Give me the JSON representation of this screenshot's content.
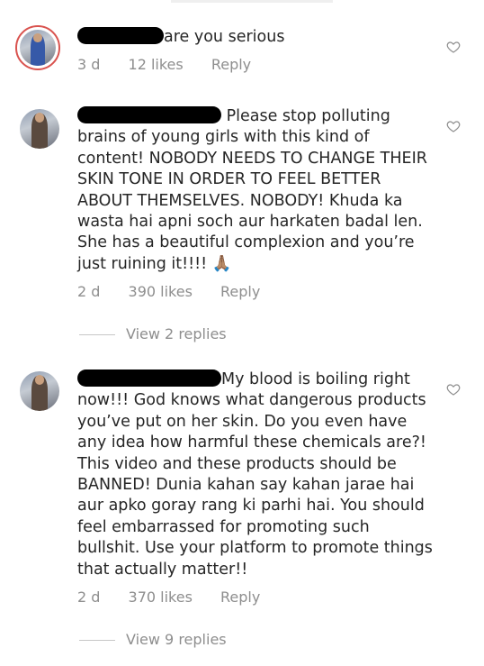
{
  "comments": [
    {
      "text": "are you serious",
      "time": "3 d",
      "likes": "12 likes",
      "reply_label": "Reply"
    },
    {
      "text": "Please stop polluting brains of young girls with this kind of content! NOBODY NEEDS TO CHANGE THEIR SKIN TONE IN ORDER TO FEEL BETTER ABOUT THEMSELVES. NOBODY! Khuda ka wasta hai apni soch aur harkaten badal len. She has a beautiful complexion and you’re just ruining it!!!! 🙏🏽",
      "time": "2 d",
      "likes": "390 likes",
      "reply_label": "Reply",
      "view_replies": "View 2 replies"
    },
    {
      "text": "My blood is boiling right now!!! God knows what dangerous products you’ve put on her skin. Do you even have any idea how harmful these chemicals are?! This video and these products should be BANNED! Dunia kahan say kahan jarae hai aur apko goray rang ki parhi hai. You should feel embarrassed for promoting such bullshit. Use your platform to promote things that actually matter!!",
      "time": "2 d",
      "likes": "370 likes",
      "reply_label": "Reply",
      "view_replies": "View 9 replies"
    }
  ],
  "icons": {
    "like": "heart-outline-icon",
    "avatar": "user-avatar"
  },
  "colors": {
    "text": "#262626",
    "secondary": "#8e8e8e",
    "redaction": "#000000",
    "story_ring": "#d9534f"
  }
}
